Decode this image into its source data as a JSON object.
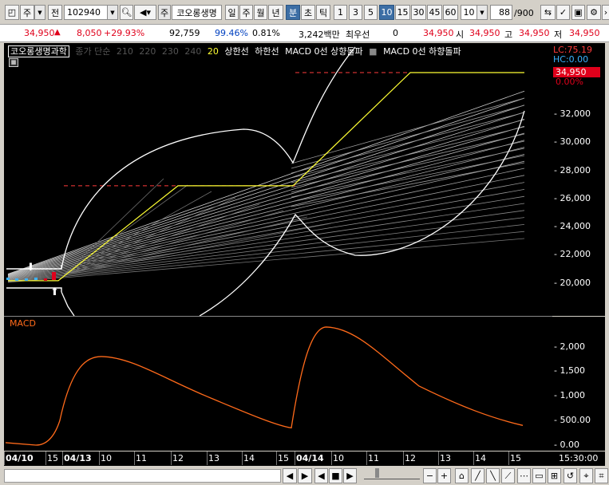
{
  "toolbar": {
    "period_main": "주",
    "period_sub": "전",
    "code": "102940",
    "stock_name": "코오롱생명",
    "stock_prefix": "주",
    "periods": [
      "일",
      "주",
      "월",
      "년"
    ],
    "intraday": [
      "분",
      "초",
      "틱"
    ],
    "minutes": [
      "1",
      "3",
      "5",
      "10",
      "15",
      "30",
      "45",
      "60"
    ],
    "selected_minute": "10",
    "interval_value": "10",
    "count_value": "88",
    "count_total": "/900"
  },
  "quote": {
    "price": "34,950",
    "change": "8,050",
    "change_pct": "+29.93%",
    "volume": "92,759",
    "ratio": "99.46%",
    "turnover": "0.81%",
    "amount": "3,242백만",
    "min_label": "최우선",
    "min_value": "0",
    "current": "34,950",
    "open_label": "시",
    "open": "34,950",
    "high_label": "고",
    "high": "34,950",
    "low_label": "저",
    "low": "34,950"
  },
  "legend": {
    "name": "코오롱생명과학",
    "items": [
      "종가 단순",
      "210",
      "220",
      "230",
      "240"
    ],
    "item20": "20",
    "upper": "상한선",
    "lower": "하한선",
    "macd_up": "MACD 0선 상향돌파",
    "macd_down": "MACD 0선 하향돌파"
  },
  "axis_top": {
    "lc": "LC:75.19",
    "hc": "HC:0.00",
    "current_price": "34,950",
    "current_pct": "0.00%",
    "ticks": [
      "32,000",
      "30,000",
      "28,000",
      "26,000",
      "24,000",
      "22,000",
      "20,000"
    ]
  },
  "macd": {
    "title": "MACD",
    "ticks": [
      "2,000",
      "1,500",
      "1,000",
      "500.00",
      "0.00"
    ]
  },
  "xaxis": {
    "labels": [
      "04/10",
      "15",
      "04/13",
      "10",
      "11",
      "12",
      "13",
      "14",
      "15",
      "04/14",
      "10",
      "11",
      "12",
      "13",
      "14",
      "15"
    ],
    "time": "15:30:00"
  },
  "chart_data": {
    "type": "line",
    "price_axis": [
      18000,
      35000
    ],
    "upper_limit": 34950,
    "day2_limit": 26900,
    "macd_axis": [
      0,
      2300
    ],
    "series": [
      {
        "name": "상한선",
        "y": [
          20150,
          20150,
          26900,
          26900,
          26900,
          34950,
          34950
        ]
      },
      {
        "name": "MACD",
        "y": [
          50,
          0,
          1800,
          1250,
          350,
          2400,
          1200,
          400
        ]
      }
    ]
  },
  "colors": {
    "up": "#e0001b",
    "down": "#0040c0",
    "macd_line": "#ff6a1a",
    "limit_line": "#ffff33",
    "ref_line": "#ff3b3b"
  }
}
